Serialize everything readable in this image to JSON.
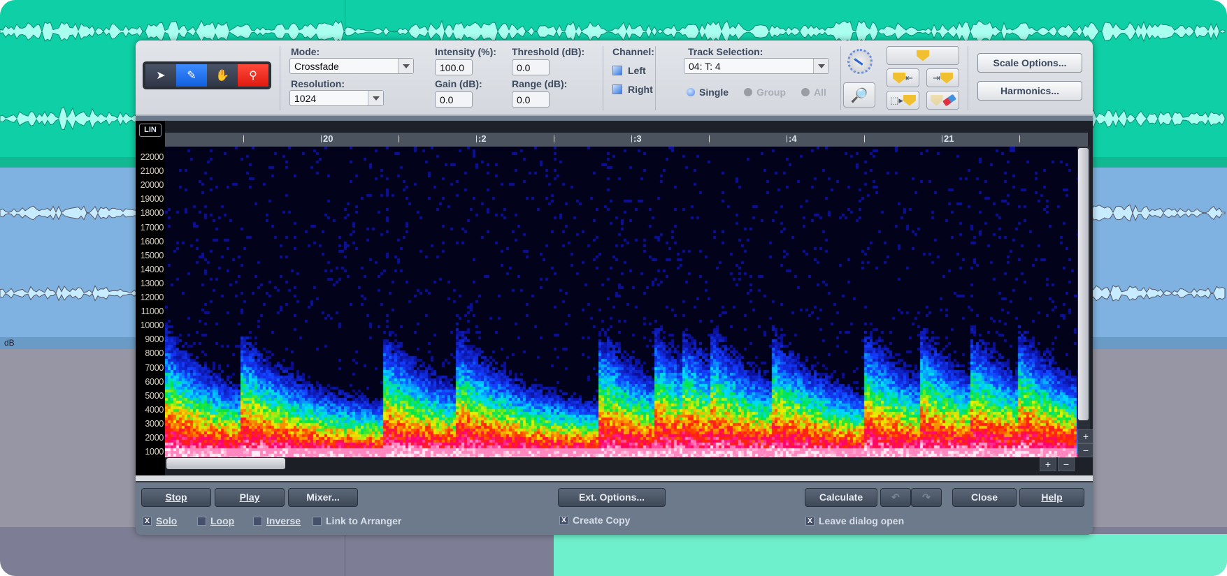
{
  "background": {
    "track_label": "dB"
  },
  "toolbar": {
    "tools": [
      {
        "name": "pointer-tool",
        "glyph": "➤",
        "selected": false
      },
      {
        "name": "pencil-tool",
        "glyph": "✎",
        "selected": true
      },
      {
        "name": "hand-tool",
        "glyph": "✋",
        "selected": false
      },
      {
        "name": "zoom-tool",
        "glyph": "🔍",
        "selected": false
      }
    ],
    "mode_label": "Mode:",
    "mode_value": "Crossfade",
    "resolution_label": "Resolution:",
    "resolution_value": "1024",
    "intensity_label": "Intensity (%):",
    "intensity_value": "100.0",
    "threshold_label": "Threshold (dB):",
    "threshold_value": "0.0",
    "gain_label": "Gain (dB):",
    "gain_value": "0.0",
    "range_label": "Range (dB):",
    "range_value": "0.0",
    "channel_label": "Channel:",
    "channel_left": "Left",
    "channel_right": "Right",
    "track_selection_label": "Track Selection:",
    "track_selection_value": "04: T:  4",
    "radio_single": "Single",
    "radio_group": "Group",
    "radio_all": "All",
    "scale_options": "Scale Options...",
    "harmonics": "Harmonics..."
  },
  "spectrogram": {
    "scale_mode": "LIN",
    "y_labels": [
      "22000",
      "21000",
      "20000",
      "19000",
      "18000",
      "17000",
      "16000",
      "15000",
      "14000",
      "13000",
      "12000",
      "11000",
      "10000",
      "9000",
      "8000",
      "7000",
      "6000",
      "5000",
      "4000",
      "3000",
      "2000",
      "1000"
    ],
    "ruler_labels": [
      "20",
      ":2",
      ":3",
      ":4",
      "21"
    ],
    "zoom_plus": "+",
    "zoom_minus": "−"
  },
  "bottom": {
    "stop": "Stop",
    "play": "Play",
    "mixer": "Mixer...",
    "ext_options": "Ext. Options...",
    "calculate": "Calculate",
    "undo": "↶",
    "redo": "↷",
    "close": "Close",
    "help": "Help",
    "solo": "Solo",
    "loop": "Loop",
    "inverse": "Inverse",
    "link_to_arranger": "Link to Arranger",
    "create_copy": "Create Copy",
    "leave_dialog_open": "Leave dialog open",
    "check_mark": "X"
  }
}
